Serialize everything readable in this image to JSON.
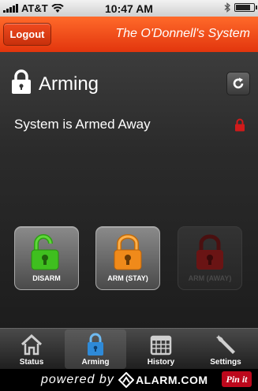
{
  "status_bar": {
    "carrier": "AT&T",
    "time": "10:47 AM"
  },
  "header": {
    "logout_label": "Logout",
    "system_title": "The O'Donnell's System"
  },
  "section": {
    "title": "Arming"
  },
  "system_status": {
    "text": "System is Armed Away"
  },
  "arm_buttons": [
    {
      "label": "DISARM",
      "color": "#3fbf1f",
      "state": "enabled"
    },
    {
      "label": "ARM (STAY)",
      "color": "#f08a1a",
      "state": "enabled"
    },
    {
      "label": "ARM (AWAY)",
      "color": "#6a1414",
      "state": "disabled"
    }
  ],
  "tabs": [
    {
      "label": "Status",
      "icon": "house-icon",
      "active": false
    },
    {
      "label": "Arming",
      "icon": "lock-icon",
      "active": true
    },
    {
      "label": "History",
      "icon": "calendar-icon",
      "active": false
    },
    {
      "label": "Settings",
      "icon": "wrench-icon",
      "active": false
    }
  ],
  "footer": {
    "powered_by": "powered by",
    "brand": "ALARM.COM",
    "pin_label": "Pin it"
  },
  "colors": {
    "header_orange": "#e2350d",
    "armed_red": "#d11a1a",
    "active_tab_blue": "#2e8ad8"
  }
}
